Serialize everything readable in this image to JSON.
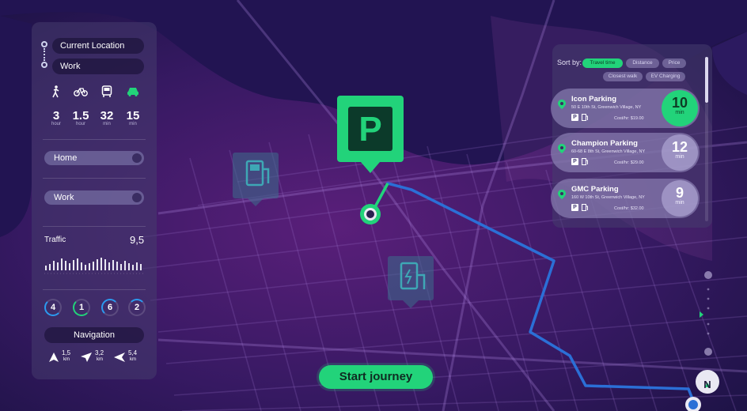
{
  "route": {
    "from": "Current Location",
    "to": "Work"
  },
  "modes": [
    {
      "icon": "walk-icon",
      "value": "3",
      "unit": "hour"
    },
    {
      "icon": "bike-icon",
      "value": "1.5",
      "unit": "hour"
    },
    {
      "icon": "bus-icon",
      "value": "32",
      "unit": "min"
    },
    {
      "icon": "car-icon",
      "value": "15",
      "unit": "min"
    }
  ],
  "places": {
    "home": "Home",
    "work": "Work"
  },
  "traffic": {
    "label": "Traffic",
    "value": "9,5"
  },
  "circles": [
    "4",
    "1",
    "6",
    "2"
  ],
  "navigation": {
    "title": "Navigation",
    "steps": [
      {
        "icon": "straight-arrow-icon",
        "distance": "1,5",
        "unit": "km"
      },
      {
        "icon": "slight-left-arrow-icon",
        "distance": "3,2",
        "unit": "km"
      },
      {
        "icon": "left-arrow-icon",
        "distance": "5,4",
        "unit": "km"
      }
    ]
  },
  "sort": {
    "label": "Sort by:",
    "options": [
      "Travel time",
      "Distance",
      "Price",
      "Closest walk",
      "EV Charging"
    ],
    "active": "Travel time"
  },
  "parking": [
    {
      "name": "Icon Parking",
      "address": "50 E 10th St, Greenwich Village, NY",
      "cost": "Cost/hr: $19.00",
      "minutes": "10",
      "unit": "min"
    },
    {
      "name": "Champion Parking",
      "address": "60-68 E 8th St, Greenwich Village, NY",
      "cost": "Cost/hr: $29.00",
      "minutes": "12",
      "unit": "min"
    },
    {
      "name": "GMC Parking",
      "address": "160 W 10th St, Greenwich Village, NY",
      "cost": "Cost/hr: $32.00",
      "minutes": "9",
      "unit": "min"
    }
  ],
  "parking_badge": "P",
  "map_parking_sign": "P",
  "start_button": "Start journey",
  "compass": "N",
  "colors": {
    "accent": "#22d37a",
    "route": "#2b6fd6",
    "background": "#2a1450",
    "water": "#2a1a5e"
  }
}
